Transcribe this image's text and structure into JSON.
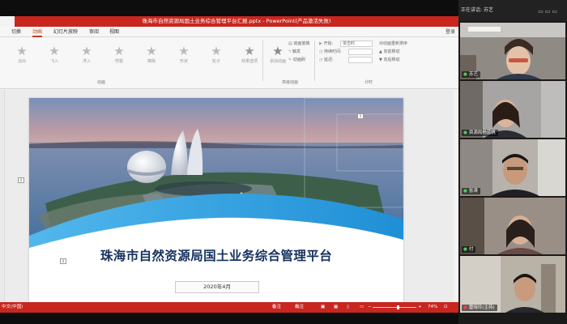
{
  "app": {
    "title": "珠海市自然资源局国土业务综合管理平台汇报.pptx  -  PowerPoint(产品激活失败)",
    "tabs": [
      "切换",
      "动画",
      "幻灯片放映",
      "审阅",
      "视图"
    ],
    "active_tab": "动画",
    "account": "登录"
  },
  "ribbon": {
    "effects": [
      "淡出",
      "飞入",
      "浮入",
      "劈裂",
      "擦除",
      "形状",
      "轮子"
    ],
    "effect_options": "效果选项",
    "add_animation": "添加动画",
    "animation_pane": "动画窗格",
    "trigger": "触发",
    "animation_painter": "动画刷",
    "start_label": "开始:",
    "start_value": "单击时",
    "duration_label": "持续时间:",
    "delay_label": "延迟:",
    "reorder": "对动画重新排序",
    "move_earlier": "向前移动",
    "move_later": "向后移动",
    "groups": [
      "动画",
      "高级动画",
      "计时"
    ]
  },
  "slide": {
    "title": "珠海市自然资源局国土业务综合管理平台",
    "date": "2020年4月",
    "marker": "0"
  },
  "status": {
    "language": "中文(中国)",
    "notes": "备注",
    "comments": "批注",
    "zoom": "74%",
    "zoom_fraction": 0.58
  },
  "meeting": {
    "speaking_label": "正在讲话:",
    "speaking_name": "苏艺",
    "participants": [
      {
        "name": "苏艺",
        "muted": false
      },
      {
        "name": "资源局杨蓝帆",
        "muted": false
      },
      {
        "name": "张涛",
        "muted": false
      },
      {
        "name": "付",
        "muted": false
      },
      {
        "name": "雷晓玲(主持)",
        "muted": true
      }
    ]
  },
  "colors": {
    "accent": "#c8261f",
    "slide_title": "#15315e",
    "wave_blue": "#1f8fd6"
  }
}
